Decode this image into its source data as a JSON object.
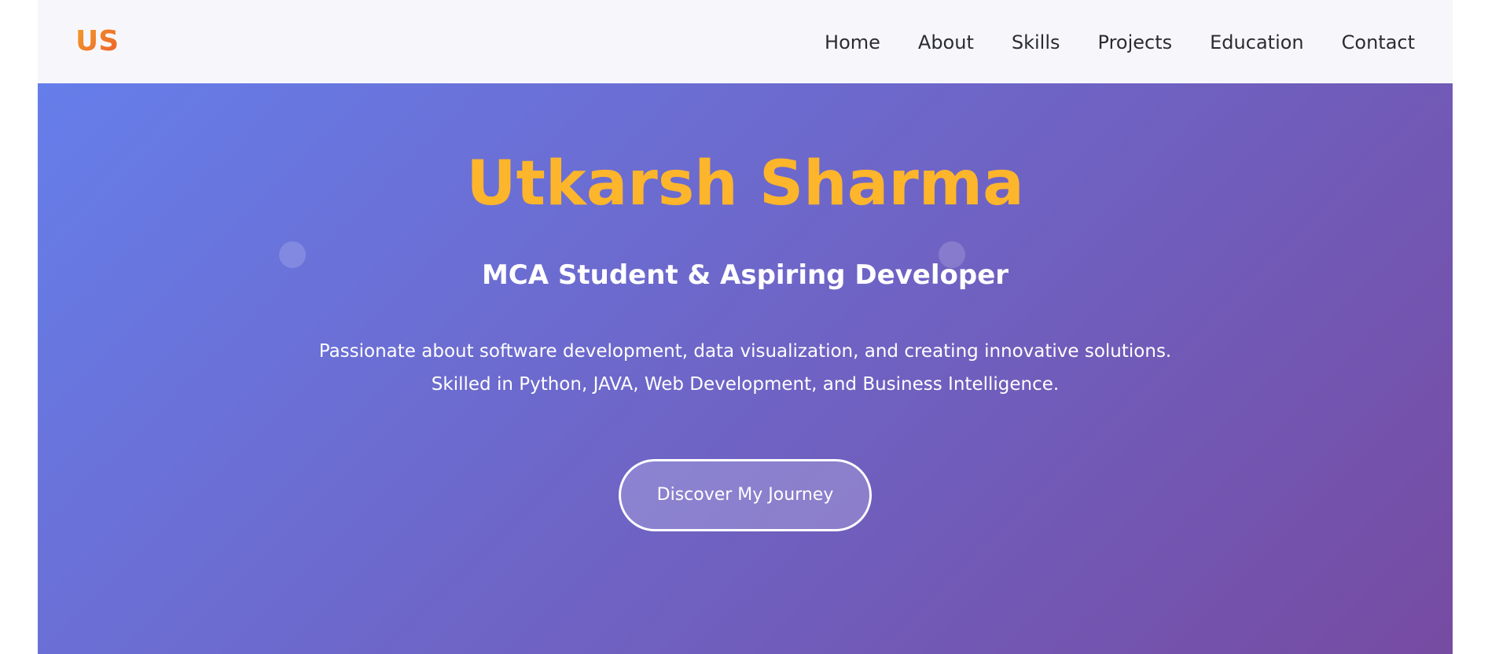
{
  "header": {
    "logo": "US",
    "nav": [
      {
        "label": "Home"
      },
      {
        "label": "About"
      },
      {
        "label": "Skills"
      },
      {
        "label": "Projects"
      },
      {
        "label": "Education"
      },
      {
        "label": "Contact"
      }
    ]
  },
  "hero": {
    "title": "Utkarsh Sharma",
    "subtitle": "MCA Student & Aspiring Developer",
    "description_line1": "Passionate about software development, data visualization, and creating innovative solutions.",
    "description_line2": "Skilled in Python, JAVA, Web Development, and Business Intelligence.",
    "cta_label": "Discover My Journey"
  },
  "colors": {
    "hero_gradient_start": "#667eea",
    "hero_gradient_end": "#764ba2",
    "title_accent": "#fdb52b",
    "logo_gradient_start": "#f0a02a",
    "logo_gradient_end": "#ef5a2a",
    "nav_background": "#f7f7fb",
    "nav_text": "#2b2b33"
  }
}
